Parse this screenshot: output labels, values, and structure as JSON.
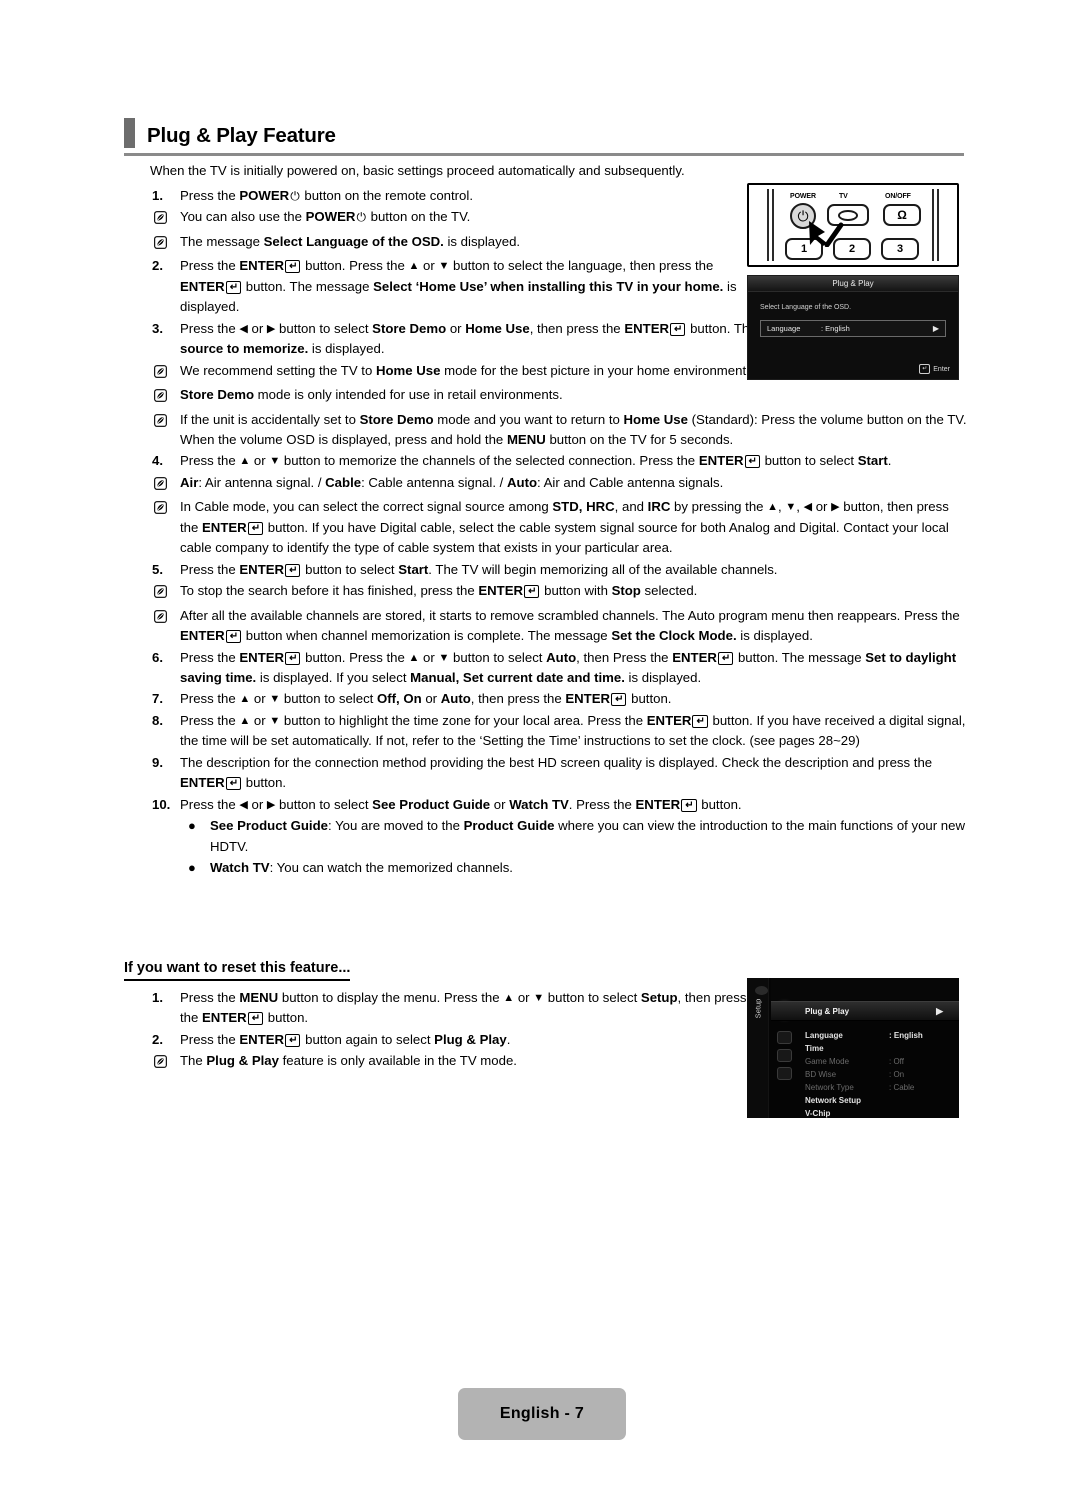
{
  "header": {
    "title": "Plug & Play Feature"
  },
  "intro": "When the TV is initially powered on, basic settings proceed automatically and subsequently.",
  "steps": [
    {
      "num": "1.",
      "html": "Press the <b>POWER</b><span class=\"power-glyph\">&#9211;</span> button on the remote control.",
      "width": "narrow",
      "subs": [
        {
          "type": "note",
          "html": "You can also use the <b>POWER</b><span class=\"power-glyph\">&#9211;</span> button on the TV.",
          "width": "narrow"
        },
        {
          "type": "note",
          "html": "The message <b>Select Language of the OSD.</b> is displayed.",
          "width": "narrow"
        }
      ]
    },
    {
      "num": "2.",
      "html": "Press the <b>ENTER</b><span class=\"enter-glyph\">&#8629;</span> button. Press the <span class=\"arrow-g\">&#9650;</span> or <span class=\"arrow-g\">&#9660;</span> button to select the language, then press the <b>ENTER</b><span class=\"enter-glyph\">&#8629;</span> button. The message <b>Select &lsquo;Home Use&rsquo; when installing this TV in your home.</b> is displayed.",
      "width": "narrow",
      "subs": []
    },
    {
      "num": "3.",
      "html": "Press the <span class=\"arrow-g\">&#9664;</span> or <span class=\"arrow-g\">&#9654;</span> button to select <b>Store Demo</b> or <b>Home Use</b>, then press the <b>ENTER</b><span class=\"enter-glyph\">&#8629;</span> button. The message <b>Select the Antenna source to memorize.</b> is displayed.",
      "width": "mid",
      "subs": [
        {
          "type": "note",
          "html": "We recommend setting the TV to <b>Home Use</b> mode for the best picture in your home environment.",
          "width": "mid"
        },
        {
          "type": "note",
          "html": "<b>Store Demo</b> mode is only intended for use in retail environments.",
          "width": "mid"
        },
        {
          "type": "note",
          "html": "If the unit is accidentally set to <b>Store Demo</b> mode and you want to return to <b>Home Use</b> (Standard): Press the volume button on the TV. When the volume OSD is displayed, press and hold the <b>MENU</b> button on the TV for 5 seconds.",
          "width": "full"
        }
      ]
    },
    {
      "num": "4.",
      "html": "Press the <span class=\"arrow-g\">&#9650;</span> or <span class=\"arrow-g\">&#9660;</span> button to memorize the channels of the selected connection. Press the <b>ENTER</b><span class=\"enter-glyph\">&#8629;</span> button to select <b>Start</b>.",
      "width": "full",
      "subs": [
        {
          "type": "note",
          "html": "<b>Air</b>: Air antenna signal. / <b>Cable</b>: Cable antenna signal. / <b>Auto</b>: Air and Cable antenna signals.",
          "width": "full"
        },
        {
          "type": "note",
          "html": "In Cable mode, you can select the correct signal source among <b>STD, HRC</b>, and <b>IRC</b> by pressing the <span class=\"arrow-g\">&#9650;</span>, <span class=\"arrow-g\">&#9660;</span>, <span class=\"arrow-g\">&#9664;</span> or <span class=\"arrow-g\">&#9654;</span> button, then press the <b>ENTER</b><span class=\"enter-glyph\">&#8629;</span> button. If you have Digital cable, select the cable system signal source for both Analog and Digital. Contact your local cable company to identify the type of cable system that exists in your particular area.",
          "width": "full"
        }
      ]
    },
    {
      "num": "5.",
      "html": "Press the <b>ENTER</b><span class=\"enter-glyph\">&#8629;</span> button to select <b>Start</b>. The TV will begin memorizing all of the available channels.",
      "width": "full",
      "subs": [
        {
          "type": "note",
          "html": "To stop the search before it has finished, press the <b>ENTER</b><span class=\"enter-glyph\">&#8629;</span> button with <b>Stop</b> selected.",
          "width": "full"
        },
        {
          "type": "note",
          "html": "After all the available channels are stored, it starts to remove scrambled channels. The Auto program menu then reappears. Press the <b>ENTER</b><span class=\"enter-glyph\">&#8629;</span> button when channel memorization is complete. The message <b>Set the Clock Mode.</b> is displayed.",
          "width": "full"
        }
      ]
    },
    {
      "num": "6.",
      "html": "Press the <b>ENTER</b><span class=\"enter-glyph\">&#8629;</span> button. Press the <span class=\"arrow-g\">&#9650;</span> or <span class=\"arrow-g\">&#9660;</span> button to select <b>Auto</b>, then Press the <b>ENTER</b><span class=\"enter-glyph\">&#8629;</span> button. The message <b>Set to daylight saving time.</b> is displayed. If you select <b>Manual, Set current date and time.</b> is displayed.",
      "width": "full",
      "subs": []
    },
    {
      "num": "7.",
      "html": "Press the <span class=\"arrow-g\">&#9650;</span> or <span class=\"arrow-g\">&#9660;</span> button to select <b>Off, On</b> or <b>Auto</b>, then press the <b>ENTER</b><span class=\"enter-glyph\">&#8629;</span> button.",
      "width": "full",
      "subs": []
    },
    {
      "num": "8.",
      "html": "Press the <span class=\"arrow-g\">&#9650;</span> or <span class=\"arrow-g\">&#9660;</span> button to highlight the time zone for your local area. Press the <b>ENTER</b><span class=\"enter-glyph\">&#8629;</span> button. If you have received a digital signal, the time will be set automatically. If not, refer to the &lsquo;Setting the Time&rsquo; instructions to set the clock. (see pages 28~29)",
      "width": "full",
      "subs": []
    },
    {
      "num": "9.",
      "html": "The description for the connection method providing the best HD screen quality is displayed. Check the description and press the <b>ENTER</b><span class=\"enter-glyph\">&#8629;</span> button.",
      "width": "full",
      "subs": []
    },
    {
      "num": "10.",
      "html": "Press the <span class=\"arrow-g\">&#9664;</span> or <span class=\"arrow-g\">&#9654;</span> button to select <b>See Product Guide</b> or <b>Watch TV</b>. Press the <b>ENTER</b><span class=\"enter-glyph\">&#8629;</span> button.",
      "width": "full",
      "subs": [
        {
          "type": "bullet",
          "html": "<b>See Product Guide</b>: You are moved to the <b>Product Guide</b> where you can view the introduction to the main functions of your new HDTV.",
          "width": "full"
        },
        {
          "type": "bullet",
          "html": "<b>Watch TV</b>: You can watch the memorized channels.",
          "width": "full"
        }
      ]
    }
  ],
  "reset": {
    "heading": "If you want to reset this feature...",
    "steps": [
      {
        "num": "1.",
        "html": "Press the <b>MENU</b> button to display the menu. Press the <span class=\"arrow-g\">&#9650;</span> or <span class=\"arrow-g\">&#9660;</span> button to select <b>Setup</b>, then press the <b>ENTER</b><span class=\"enter-glyph\">&#8629;</span> button.",
        "width": "narrow",
        "subs": []
      },
      {
        "num": "2.",
        "html": "Press the <b>ENTER</b><span class=\"enter-glyph\">&#8629;</span> button again to select <b>Plug &amp; Play</b>.",
        "width": "narrow",
        "subs": [
          {
            "type": "note",
            "html": "The <b>Plug &amp; Play</b> feature is only available in the TV mode.",
            "width": "narrow"
          }
        ]
      }
    ]
  },
  "figure_remote": {
    "power_label": "POWER",
    "tv_label": "TV",
    "onoff_label": "ON/OFF",
    "power_glyph": "⏻",
    "lamp_glyph": "Ω",
    "num_buttons": [
      "1",
      "2",
      "3"
    ]
  },
  "figure_osd_language": {
    "title": "Plug & Play",
    "message": "Select Language of the OSD.",
    "row_label": "Language",
    "row_value": ": English",
    "row_arrow": "▶",
    "footer_label": "Enter"
  },
  "figure_osd_setup": {
    "side_label": "Setup",
    "selected_item": "Plug & Play",
    "selected_arrow": "▶",
    "items": [
      {
        "name": "Language",
        "value": ": English",
        "state": "norm"
      },
      {
        "name": "Time",
        "value": "",
        "state": "norm"
      },
      {
        "name": "Game Mode",
        "value": ": Off",
        "state": "dim"
      },
      {
        "name": "BD Wise",
        "value": ": On",
        "state": "dim"
      },
      {
        "name": "Network Type",
        "value": ": Cable",
        "state": "dim"
      },
      {
        "name": "Network Setup",
        "value": "",
        "state": "norm"
      },
      {
        "name": "V-Chip",
        "value": "",
        "state": "norm"
      }
    ]
  },
  "footer": {
    "label": "English - 7"
  },
  "colors": {
    "header_bar": "#6d6d6d",
    "header_rule": "#8a8a8a",
    "footer_bg": "#b3b3b3",
    "osd_bg": "#0d0d0d"
  }
}
